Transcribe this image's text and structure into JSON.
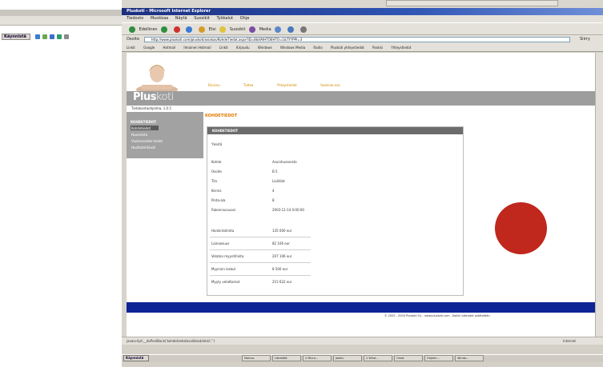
{
  "browser": {
    "title": "Pluskoti - Microsoft Internet Explorer",
    "menu": [
      "Tiedosto",
      "Muokkaa",
      "Näytä",
      "Suosikit",
      "Työkalut",
      "Ohje"
    ],
    "toolbar": {
      "back": "Edellinen",
      "search": "Etsi",
      "favorites": "Suosikit",
      "media": "Media"
    },
    "address_label": "Osoite",
    "address_value": "http://www.pluskoti.com/pluskoti/asiakas/KohdeTiedot.aspx?ID=8&VAIHTOEHTO=1&TYYPPI=3",
    "go_label": "Siirry",
    "links_label": "Linkit",
    "links": [
      "Google",
      "Hotmail",
      "Ilmainen Hotmail",
      "Linkit",
      "Kirjaudu",
      "Windows",
      "Windows Media",
      "Radio",
      "Pluskoti yhteystiedot",
      "Pankki",
      "Yhteystiedot"
    ],
    "status_text": "javascript:__doPostBack('kohdetiedot$valikko$linkki','')",
    "status_zone": "Internet"
  },
  "page": {
    "top_nav": [
      "Etusivu",
      "Tietoa",
      "Yhteystiedot",
      "Vuokraa osa"
    ],
    "logo_main": "Plus",
    "logo_suffix": "koti",
    "logo_sub": "Tietokantaohjelma, 1.0.5",
    "sidebar_title": "KOHDETIEDOT",
    "sidebar_items": [
      "Kohdetiedot",
      "Huoneisto",
      "Vuokrasuhde tiedot",
      "Huoltotehtävät"
    ],
    "breadcrumb": "KOHDETIEDOT",
    "panel_title": "KOHDETIEDOT",
    "panel_subtitle": "Yleistä",
    "details": [
      {
        "k": "Kohde",
        "v": "Asuinhuoneisto"
      },
      {
        "k": "Osoite",
        "v": "B 5"
      },
      {
        "k": "Tila",
        "v": "Lisätilat"
      },
      {
        "k": "Kerros",
        "v": "4"
      },
      {
        "k": "Pinta-ala",
        "v": "8"
      },
      {
        "k": "Rakennusvuosi",
        "v": "2003-11-14 0:00:00"
      }
    ],
    "costs": [
      {
        "k": "Hankintahinta",
        "v": "135 000 eur"
      },
      {
        "k": "Lainaosuus",
        "v": "82 106 eur"
      },
      {
        "k": "Velaton myyntihinta",
        "v": "207 106 eur"
      },
      {
        "k": "Myynnin laskut",
        "v": "8 500 eur"
      },
      {
        "k": "Myyty velattomat",
        "v": "215 622 eur"
      }
    ],
    "copyright": "© 2003 - 2004 Pluskoti Oy - www.pluskoti.com - Kaikki oikeudet pidätetään"
  },
  "taskbar": {
    "start_label": "Käynnistä",
    "tasks": [
      "Mainos",
      "Lähettää",
      "2 Micro...",
      "Jakelu",
      "2 Wind...",
      "Omat",
      "Ohjelm...",
      "Windo..."
    ]
  },
  "colors": {
    "accent_orange": "#e07a00",
    "footer_blue": "#0d2496",
    "annotation_red": "#c0271d"
  }
}
